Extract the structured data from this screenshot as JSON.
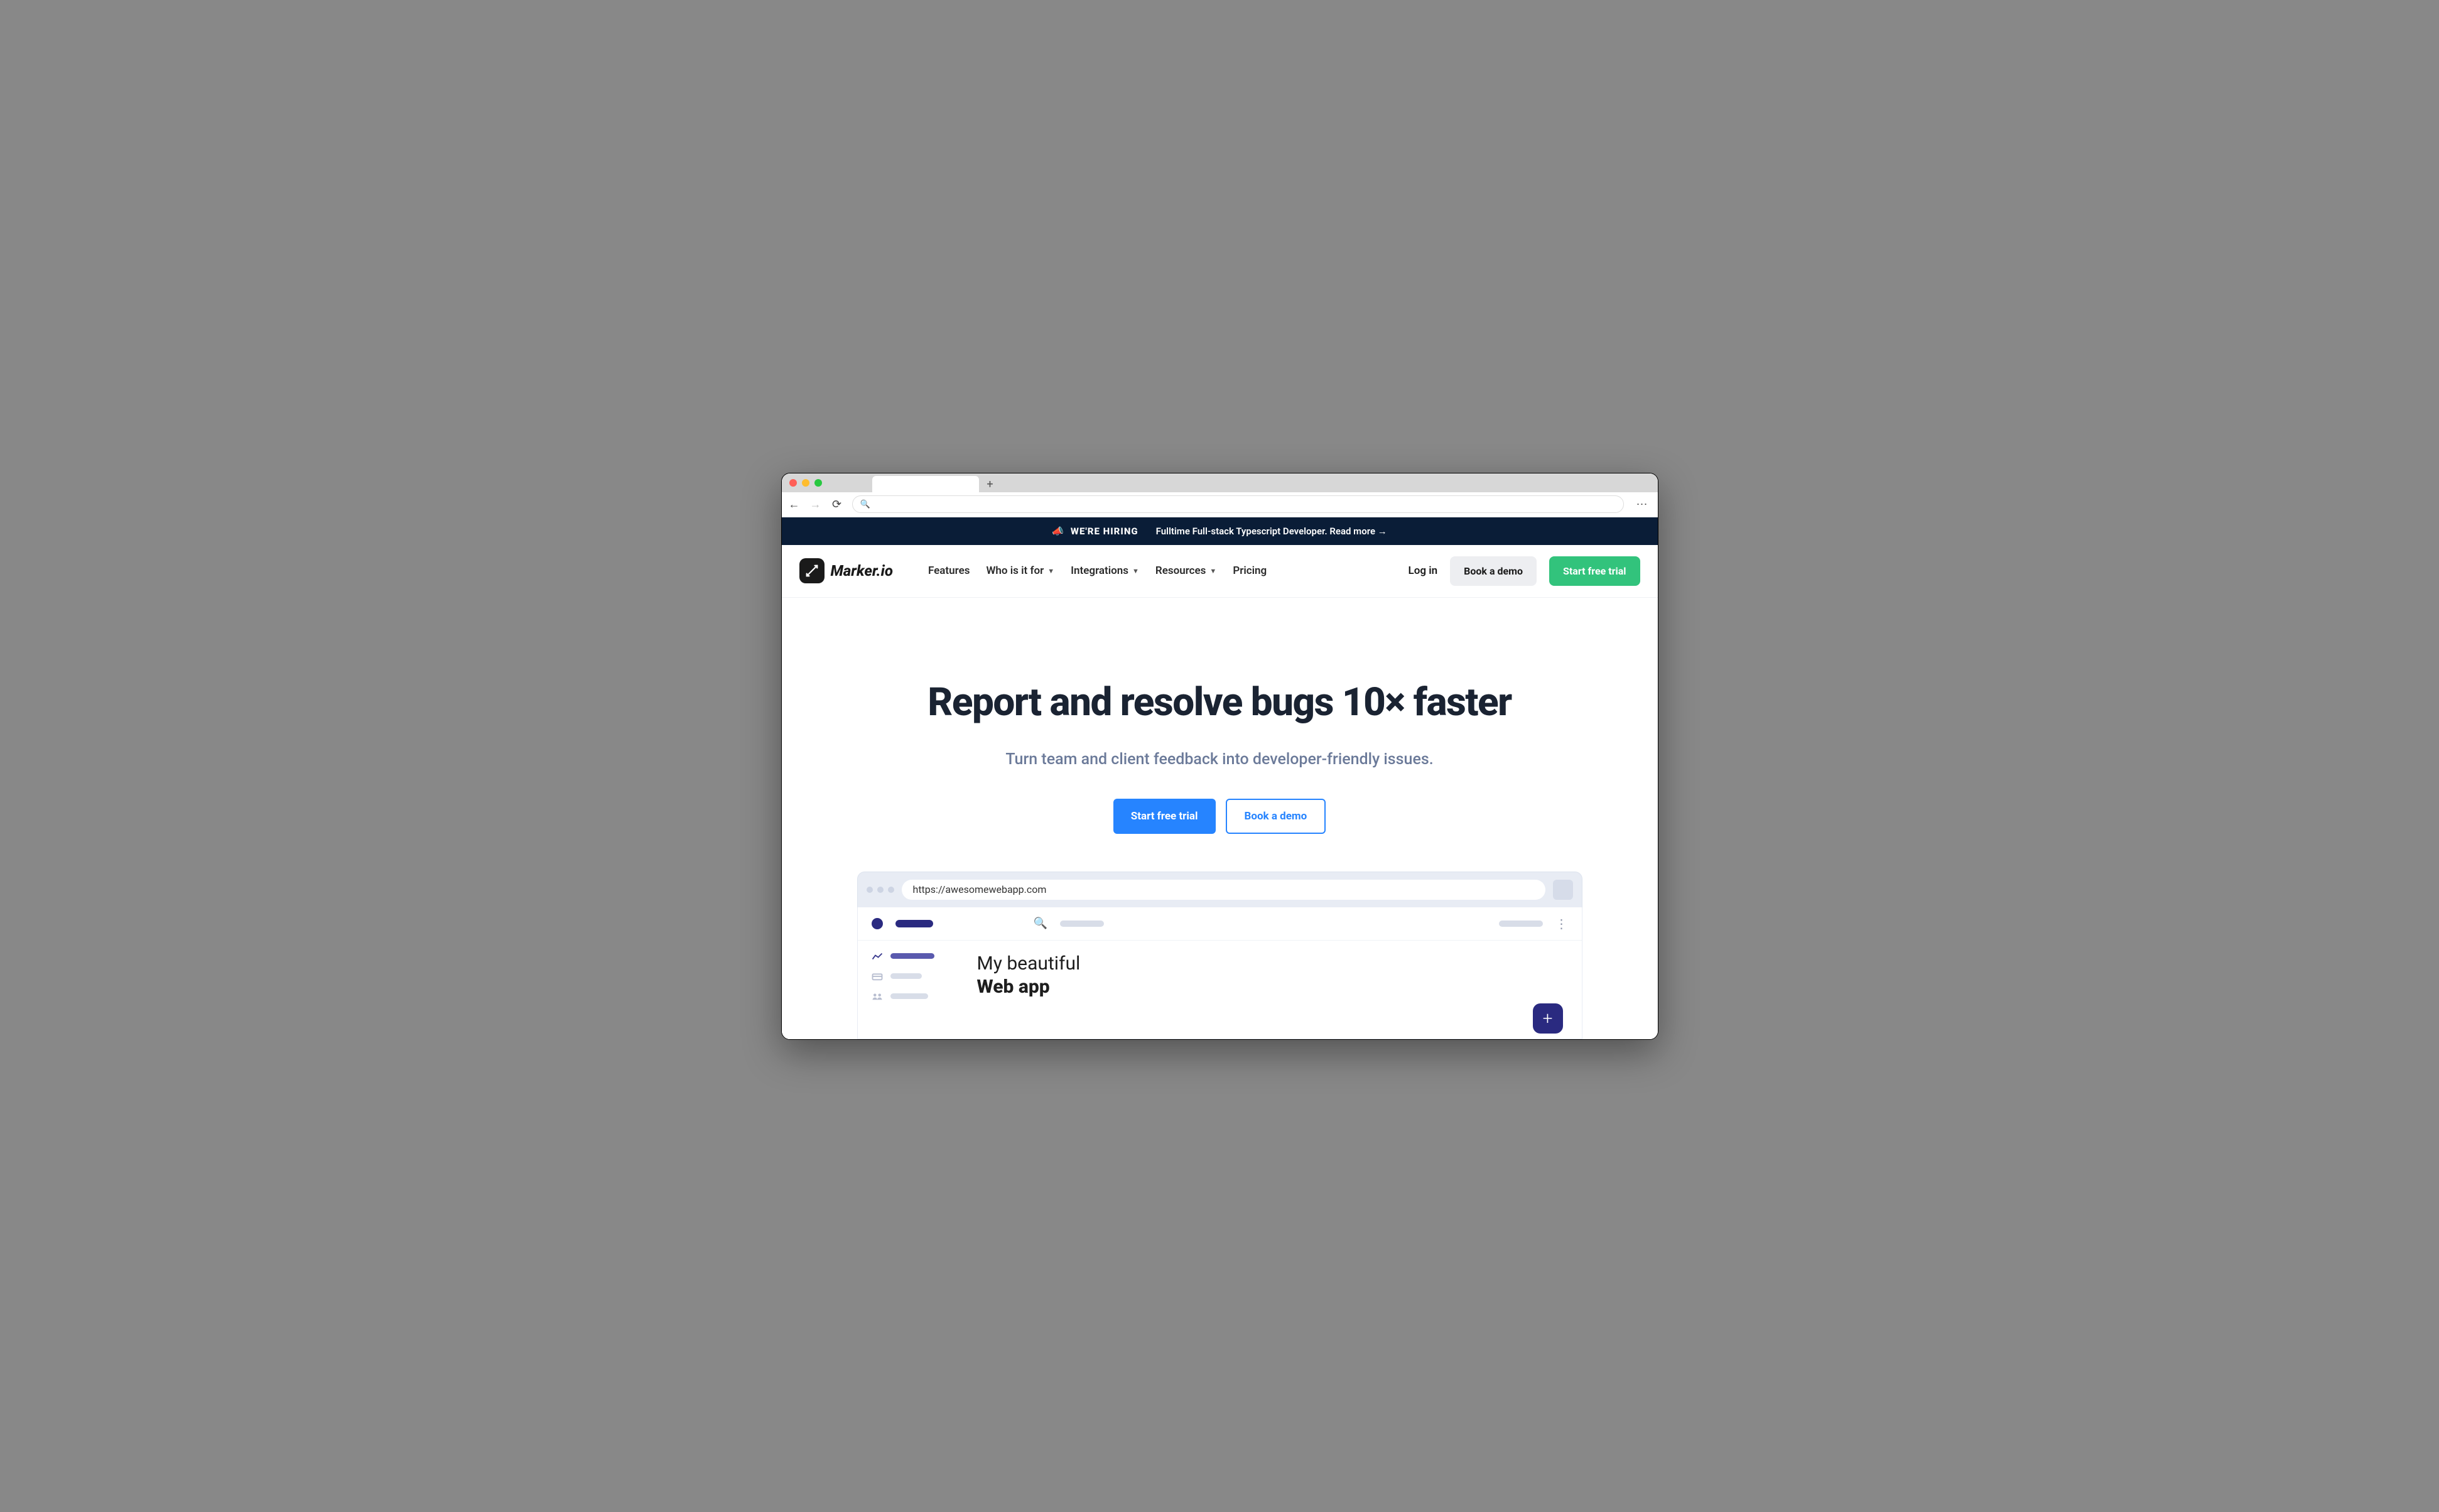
{
  "banner": {
    "hiring": "WE'RE HIRING",
    "message": "Fulltime Full-stack Typescript Developer. Read more →"
  },
  "brand": "Marker.io",
  "nav": {
    "features": "Features",
    "who": "Who is it for",
    "integrations": "Integrations",
    "resources": "Resources",
    "pricing": "Pricing"
  },
  "header": {
    "login": "Log in",
    "demo": "Book a demo",
    "trial": "Start free trial"
  },
  "hero": {
    "title": "Report and resolve bugs 10× faster",
    "subtitle": "Turn team and client feedback into developer-friendly issues.",
    "primary": "Start free trial",
    "secondary": "Book a demo"
  },
  "mock": {
    "url": "https://awesomewebapp.com",
    "title_line1": "My beautiful",
    "title_line2": "Web app"
  }
}
